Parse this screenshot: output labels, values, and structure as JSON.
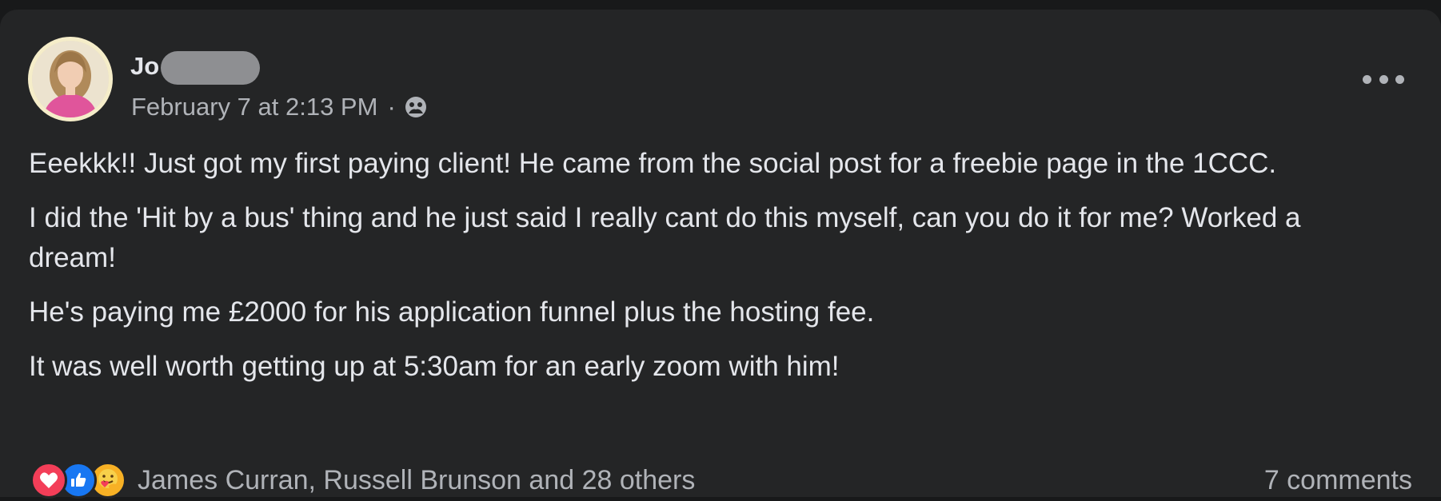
{
  "post": {
    "author": {
      "name_visible": "Jo",
      "avatar": "profile-photo"
    },
    "timestamp": "February 7 at 2:13 PM",
    "separator": "·",
    "audience_icon": "group-icon",
    "menu_icon": "more-options-icon",
    "paragraphs": [
      "Eeekkk!! Just got my first paying client! He came from the social post for a freebie page in the 1CCC.",
      "I did the 'Hit by a bus' thing and he just said I really cant do this myself, can you do it for me? Worked a dream!",
      "He's paying me £2000 for his application funnel plus the hosting fee.",
      "It was well worth getting up at 5:30am for an early zoom with him!"
    ],
    "reactions": {
      "icons": [
        "love-icon",
        "like-icon",
        "care-icon"
      ],
      "summary": "James Curran, Russell Brunson and 28 others"
    },
    "comments": "7 comments"
  },
  "colors": {
    "card_background": "#242526",
    "page_background": "#18191a",
    "primary_text": "#e4e6eb",
    "secondary_text": "#b0b3b8",
    "love": "#f33e58",
    "like": "#1877f2",
    "care": "#f7b125"
  }
}
